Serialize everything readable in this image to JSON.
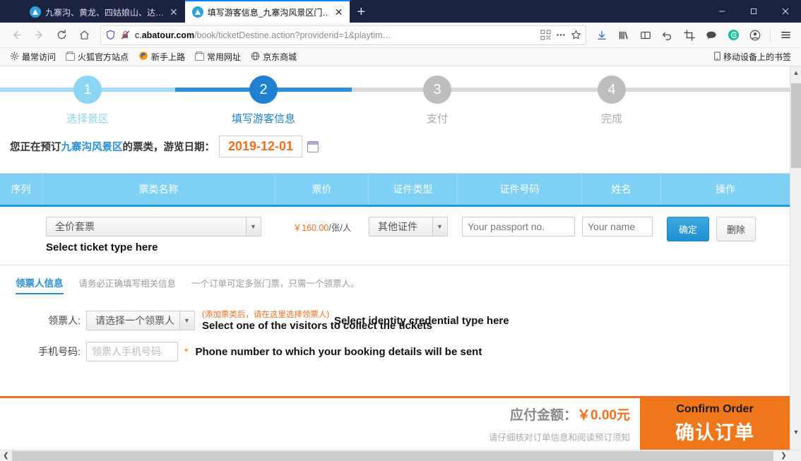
{
  "browser": {
    "tabs": [
      {
        "title": "九寨沟、黄龙、四姑娘山、达…",
        "active": false
      },
      {
        "title": "填写游客信息_九寨沟风景区门…",
        "active": true
      }
    ],
    "newtab_label": "+",
    "close_label": "✕",
    "url": {
      "prefix": "c.",
      "host": "abatour.com",
      "path": "/book/ticketDestine.action?providerid=1&playtim…",
      "full": "c.abatour.com/book/ticketDestine.action?providerid=1&playtim"
    },
    "nav": {
      "back": "back-arrow",
      "forward": "forward-arrow",
      "reload": "reload",
      "home": "home"
    },
    "window_controls": {
      "minimize": "—",
      "maximize": "▢",
      "close": "✕"
    },
    "bookmarks": [
      {
        "label": "最常访问",
        "icon": "gear-icon"
      },
      {
        "label": "火狐官方站点",
        "icon": "folder-icon"
      },
      {
        "label": "新手上路",
        "icon": "firefox-icon"
      },
      {
        "label": "常用网址",
        "icon": "folder-icon"
      },
      {
        "label": "京东商城",
        "icon": "globe-icon"
      }
    ],
    "bookmarks_right": {
      "label": "移动设备上的书签",
      "icon": "mobile-icon"
    },
    "toolbar_icons": [
      "download-icon",
      "library-icon",
      "sidebar-icon",
      "undo-icon",
      "crop-icon",
      "chat-icon",
      "grammarly-icon",
      "account-icon",
      "menu-icon"
    ]
  },
  "steps": [
    {
      "num": "1",
      "label": "选择景区",
      "color": "#8bd5f5",
      "state": "done"
    },
    {
      "num": "2",
      "label": "填写游客信息",
      "color": "#1f7fd0",
      "state": "current"
    },
    {
      "num": "3",
      "label": "支付",
      "color": "#bdbdbd",
      "state": "todo"
    },
    {
      "num": "4",
      "label": "完成",
      "color": "#bdbdbd",
      "state": "todo"
    }
  ],
  "booking": {
    "prefix": "您正在预订",
    "spot": "九寨沟风景区",
    "middle": "的票类，游览日期：",
    "date": "2019-12-01",
    "calendar_icon": "calendar-icon"
  },
  "table": {
    "headers": [
      "序列",
      "票类名称",
      "票价",
      "证件类型",
      "证件号码",
      "姓名",
      "操作"
    ],
    "row": {
      "index": "",
      "ticket_type": "全价套票",
      "ticket_type_annotation": "Select ticket type here",
      "price": "￥160.00",
      "price_unit": "/张/人",
      "credential_type": "其他证件",
      "credential_annotation": "Select identity credential type here",
      "passport_placeholder": "Your passport no.",
      "name_placeholder": "Your name",
      "confirm_label": "确定",
      "delete_label": "删除"
    }
  },
  "collector": {
    "tab_label": "领票人信息",
    "hint1": "请务必正确填写相关信息",
    "hint2": "一个订单可定多张门票，只需一个领票人。",
    "picker_label": "领票人:",
    "picker_value": "请选择一个领票人",
    "picker_hint_red": "(添加票类后，请在这里选择领票人)",
    "picker_annotation": "Select one of the visitors to collect the tickets",
    "phone_label": "手机号码:",
    "phone_placeholder": "领票人手机号码",
    "phone_required": "*",
    "phone_annotation": "Phone number to which your booking details will be sent"
  },
  "bottom": {
    "amount_label": "应付金额：",
    "amount_value": "￥0.00元",
    "note": "请仔细核对订单信息和阅读预订须知",
    "confirm_en": "Confirm Order",
    "confirm_cn": "确认订单"
  },
  "colors": {
    "accent_blue": "#2a8fd8",
    "orange": "#f26f21",
    "table_header": "#7ed0f5"
  }
}
